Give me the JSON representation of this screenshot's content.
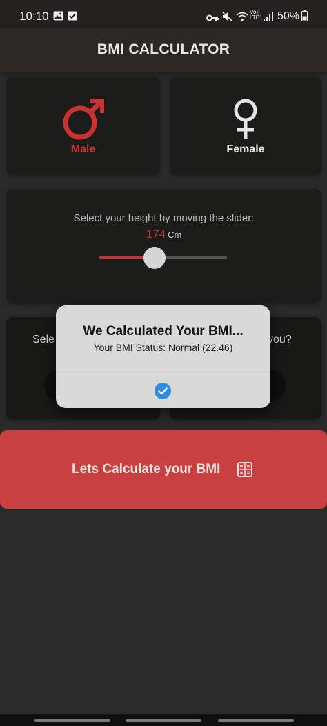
{
  "status_bar": {
    "time": "10:10",
    "battery": "50%",
    "icons": [
      "gallery-icon",
      "check-box-icon",
      "key-icon",
      "mute-icon",
      "wifi-icon",
      "volte-icon",
      "signal-icon",
      "battery-icon"
    ],
    "volte_label": "Vo))",
    "lte_label": "LTE1"
  },
  "app_bar": {
    "title": "BMI CALCULATOR"
  },
  "gender": {
    "male": {
      "label": "Male",
      "icon": "male-symbol-icon",
      "selected": true
    },
    "female": {
      "label": "Female",
      "icon": "female-symbol-icon",
      "selected": false
    }
  },
  "height": {
    "prompt": "Select your height by moving the slider:",
    "value": "174",
    "unit": "Cm",
    "slider_fraction": 0.43
  },
  "weight_card": {
    "partial_label": "Sele"
  },
  "age_card": {
    "partial_label": "you?"
  },
  "calculate_button": {
    "label": "Lets Calculate your BMI",
    "icon": "calculator-icon"
  },
  "dialog": {
    "title": "We Calculated Your BMI...",
    "message": "Your BMI Status: Normal (22.46)",
    "confirm_icon": "check-circle-icon"
  },
  "colors": {
    "accent": "#c8332f",
    "button": "#c84040",
    "dialog_confirm": "#2c8ce6",
    "background": "#2a2a2a"
  }
}
